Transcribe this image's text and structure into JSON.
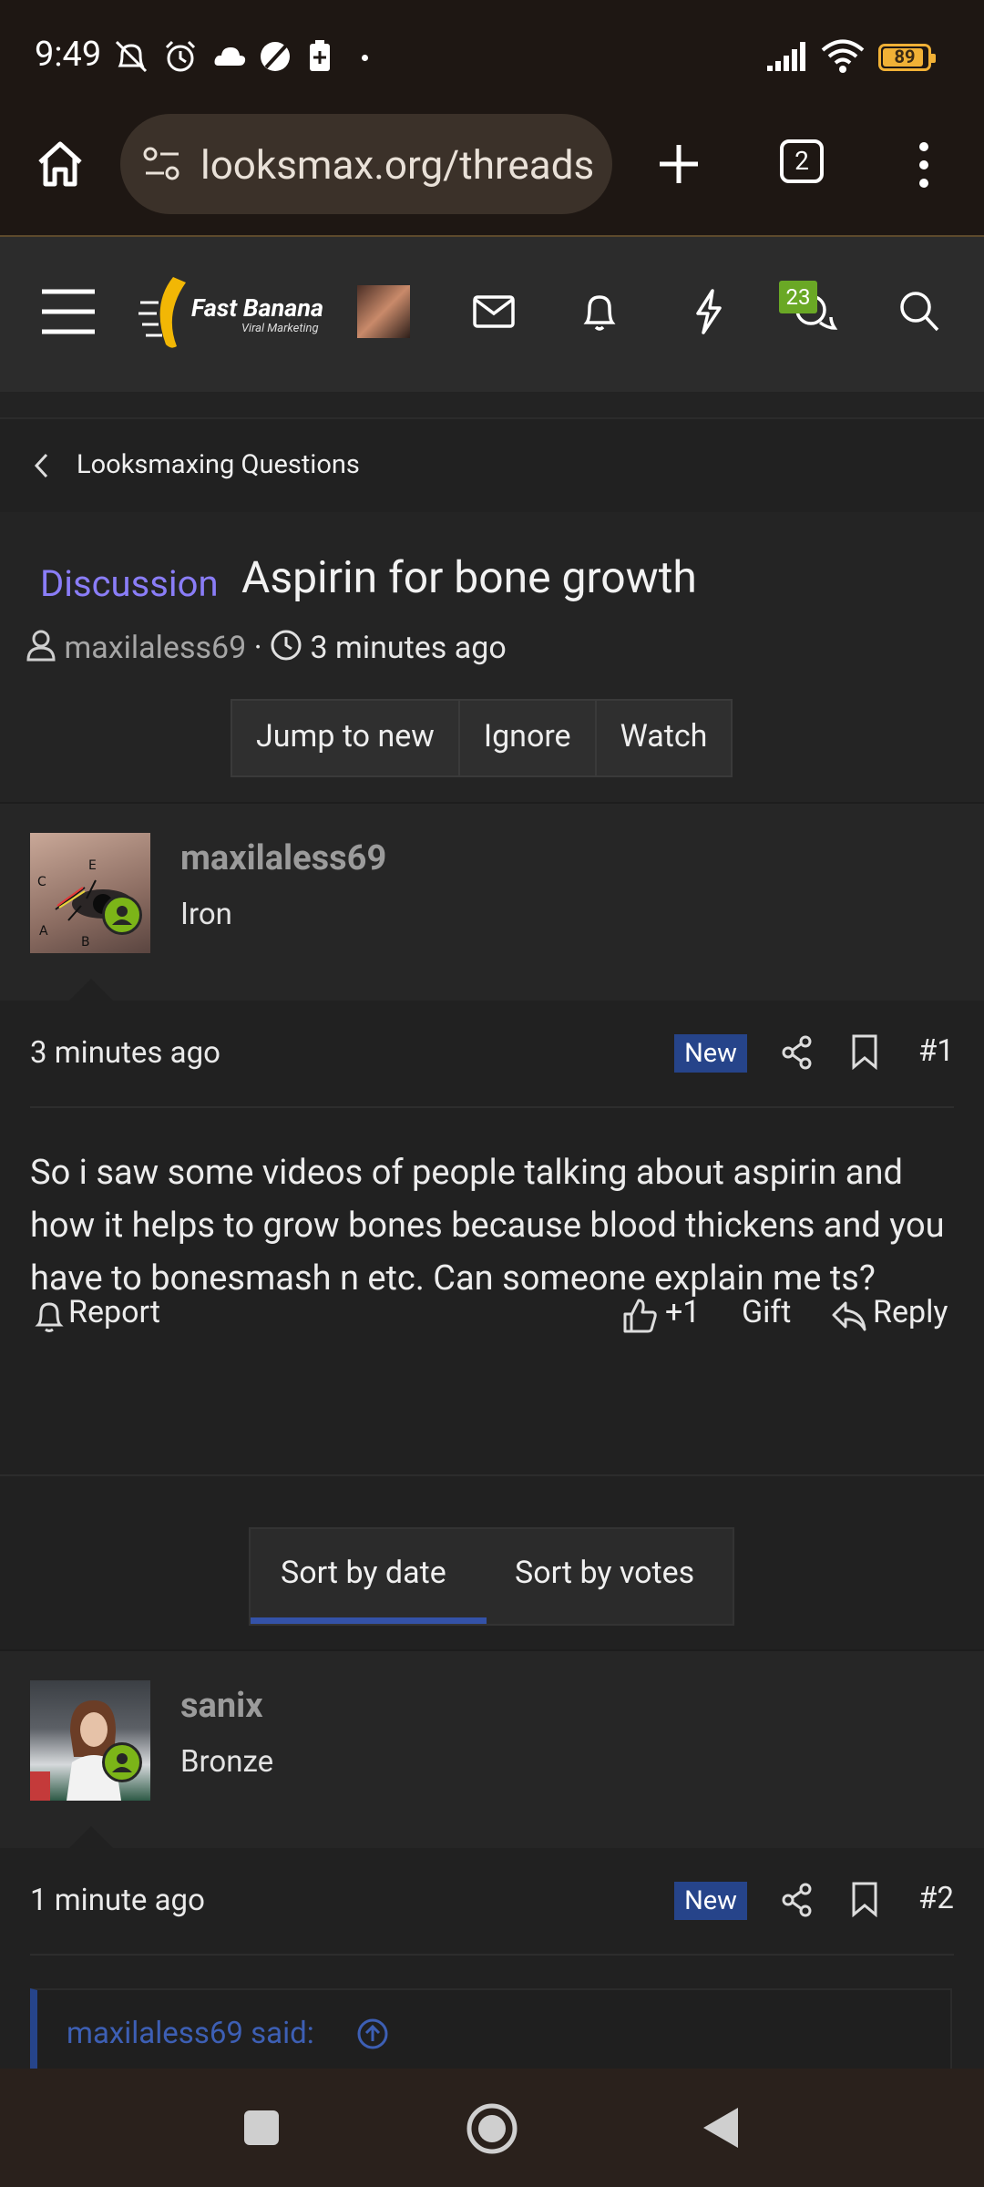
{
  "status_bar": {
    "time": "9:49",
    "battery": "89"
  },
  "browser": {
    "url": "looksmax.org/threads",
    "tab_count": "2"
  },
  "forum_header": {
    "logo_text": "Fast Banana",
    "logo_sub": "Viral Marketing",
    "chat_badge": "23"
  },
  "breadcrumb": {
    "label": "Looksmaxing Questions"
  },
  "thread": {
    "prefix": "Discussion",
    "title": "Aspirin for bone growth",
    "author": "maxilaless69",
    "separator": "·",
    "time": "3 minutes ago",
    "actions": [
      "Jump to new",
      "Ignore",
      "Watch"
    ]
  },
  "posts": [
    {
      "username": "maxilaless69",
      "user_title": "Iron",
      "time": "3 minutes ago",
      "badge": "New",
      "number": "#1",
      "text": "So i saw some videos of people talking about aspirin and how it helps to grow bones because blood thickens and you have to bonesmash n etc. Can someone explain me ts?",
      "report_label": "Report",
      "like_count": "+1",
      "gift_label": "Gift",
      "reply_label": "Reply"
    },
    {
      "username": "sanix",
      "user_title": "Bronze",
      "time": "1 minute ago",
      "badge": "New",
      "number": "#2",
      "quote_label": "maxilaless69 said:"
    }
  ],
  "sort": {
    "by_date": "Sort by date",
    "by_votes": "Sort by votes"
  },
  "colors": {
    "accent_purple": "#8a7df7",
    "new_badge": "#26448a",
    "online": "#7cb518",
    "chat_badge": "#6aa825"
  }
}
